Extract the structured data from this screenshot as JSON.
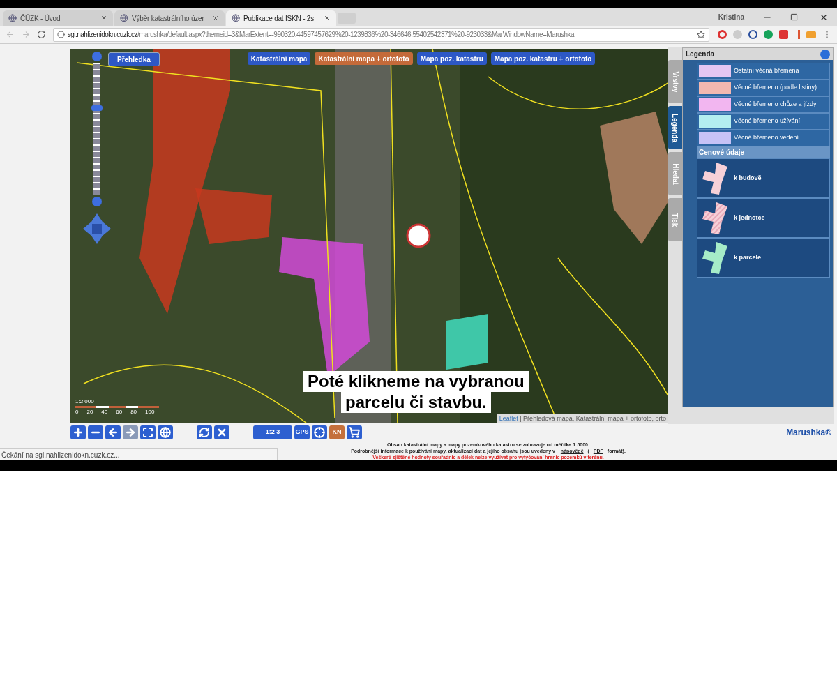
{
  "tabs": [
    {
      "label": "ČÚZK - Úvod",
      "selected": false
    },
    {
      "label": "Výběr katastrálního úzer",
      "selected": false
    },
    {
      "label": "Publikace dat ISKN - 2s",
      "selected": true
    }
  ],
  "profile": "Kristina",
  "address": {
    "host": "sgi.nahlizenidokn.cuzk.cz",
    "path": "/marushka/default.aspx?themeid=3&MarExtent=-990320.44597457629%20-1239836%20-346646.55402542371%20-923033&MarWindowName=Marushka"
  },
  "map": {
    "overview_button": "Přehledka",
    "map_types": [
      {
        "label": "Katastrální mapa",
        "selected": false
      },
      {
        "label": "Katastrální mapa + ortofoto",
        "selected": true
      },
      {
        "label": "Mapa poz. katastru",
        "selected": false
      },
      {
        "label": "Mapa poz. katastru + ortofoto",
        "selected": false
      }
    ],
    "zoom": {
      "level": 0.66
    },
    "scale": "1:2 000",
    "scale_ticks": [
      "0",
      "20",
      "40",
      "60",
      "80",
      "100"
    ],
    "attribution_link": "Leaflet",
    "attribution": "| Přehledová mapa, Katastrální mapa + ortofoto, orto",
    "caption": [
      "Poté klikneme na vybranou",
      "parcelu či stavbu."
    ]
  },
  "panel": {
    "title": "Legenda",
    "side_tabs": [
      {
        "label": "Vrstvy",
        "selected": false
      },
      {
        "label": "Legenda",
        "selected": true
      },
      {
        "label": "Hledat",
        "selected": false
      },
      {
        "label": "Tisk",
        "selected": false
      }
    ],
    "legend": [
      {
        "label": "Ostatní věcná břemena",
        "color": "#e4c6f2"
      },
      {
        "label": "Věcné břemeno (podle listiny)",
        "color": "#f2b8b0"
      },
      {
        "label": "Věcné břemeno chůze a jízdy",
        "color": "#f2b6f0"
      },
      {
        "label": "Věcné břemeno užívání",
        "color": "#b4eef0"
      },
      {
        "label": "Věcné břemeno vedení",
        "color": "#c6c2f6"
      }
    ],
    "price_heading": "Cenové údaje",
    "price_items": [
      {
        "label": "k budově",
        "color": "#f6d0d8",
        "kind": "solid"
      },
      {
        "label": "k jednotce",
        "color": "#f6d0d8",
        "kind": "striped"
      },
      {
        "label": "k parcele",
        "color": "#a6ecc8",
        "kind": "solid"
      }
    ]
  },
  "toolbar": [
    {
      "kind": "plus",
      "selected": false
    },
    {
      "kind": "minus",
      "selected": false
    },
    {
      "kind": "back",
      "selected": false
    },
    {
      "kind": "forward",
      "selected": false,
      "disabled": true
    },
    {
      "kind": "extent",
      "selected": false
    },
    {
      "kind": "globe",
      "selected": false
    },
    {
      "kind": "gap"
    },
    {
      "kind": "refresh",
      "selected": false
    },
    {
      "kind": "close",
      "selected": false
    },
    {
      "kind": "gap"
    },
    {
      "kind": "text",
      "label": "1:2 3",
      "selected": false
    },
    {
      "kind": "text",
      "label": "GPS",
      "selected": false
    },
    {
      "kind": "target",
      "selected": false
    },
    {
      "kind": "text",
      "label": "KN",
      "selected": true
    },
    {
      "kind": "cart",
      "selected": false
    }
  ],
  "brand": "Marushka®",
  "footer": {
    "line1": "Obsah katastrální mapy a mapy pozemkového katastru se zobrazuje od měřítka 1:5000.",
    "line2_before": "Podrobnější informace k používání mapy, aktualizaci dat a jejího obsahu jsou uvedeny v",
    "help_link": "nápovědě",
    "line2_mid": "(",
    "pdf_link": "PDF",
    "line2_after": "formát).",
    "warning": "Veškeré zjištěné hodnoty souřadnic a délek nelze využívat pro vytyčování hranic pozemků v terénu."
  },
  "status": "Čekání na sgi.nahlizenidokn.cuzk.cz..."
}
